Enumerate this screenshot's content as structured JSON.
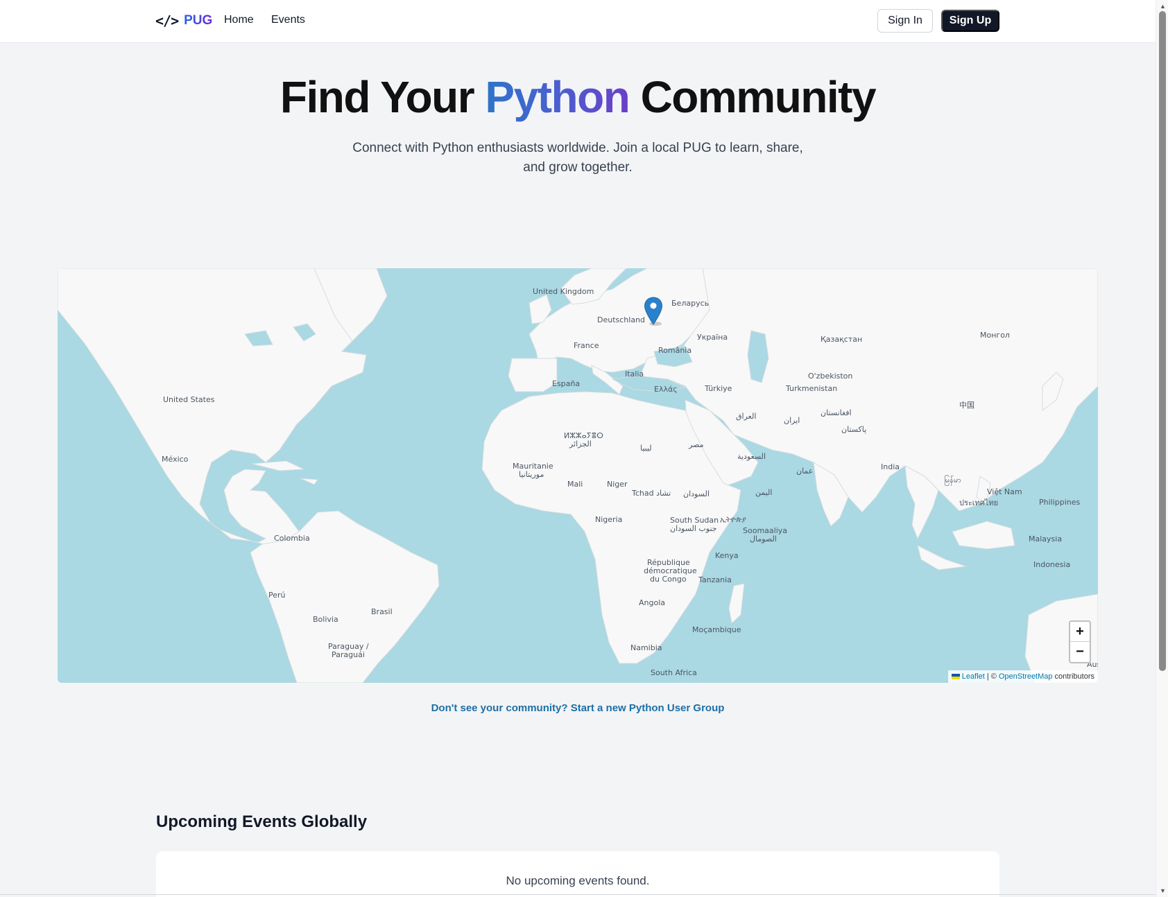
{
  "navbar": {
    "brand_icon": "</>",
    "brand_text": "PUG",
    "home": "Home",
    "events": "Events",
    "sign_in": "Sign In",
    "sign_up": "Sign Up"
  },
  "hero": {
    "title_before": "Find Your ",
    "title_accent": "Python",
    "title_after": " Community",
    "subtitle": "Connect with Python enthusiasts worldwide. Join a local PUG to learn, share, and grow together.",
    "accent_color_start": "#2f74c8",
    "accent_color_end": "#6b3fc7"
  },
  "map": {
    "labels": {
      "united_kingdom": "United Kingdom",
      "belarus": "Беларусь",
      "deutschland": "Deutschland",
      "ukraine": "Україна",
      "france": "France",
      "romania": "România",
      "kazakhstan": "Қазақстан",
      "mongolia": "Монгол",
      "uzbekistan": "O'zbekiston",
      "turkmenistan": "Turkmenistan",
      "italia": "Italia",
      "espana": "España",
      "ellas": "Ελλάς",
      "turkiye": "Türkiye",
      "united_states": "United States",
      "china": "中国",
      "iraq": "العراق",
      "iran": "ایران",
      "afghanistan": "افغانستان",
      "pakistan": "پاکستان",
      "algeria": "ⵍⵣⵣⴰⵢⴻⵔ",
      "algeria_ar": "الجزائر",
      "libya": "ليبيا",
      "egypt": "مصر",
      "mexico": "México",
      "saudi": "السعودية",
      "oman": "عمان",
      "india": "India",
      "mauritanie": "Mauritanie",
      "mauritanie_ar": "موريتانيا",
      "mali": "Mali",
      "niger": "Niger",
      "tchad": "Tchad تشاد",
      "sudan": "السودان",
      "yemen": "اليمن",
      "myanmar": "မြန်မာ",
      "vietnam": "Việt Nam",
      "thailand": "ประเทศไทย",
      "philippines": "Philippines",
      "nigeria": "Nigeria",
      "south_sudan": "South Sudan",
      "south_sudan_ar": "جنوب السودان",
      "ethiopia": "ኢትዮጵያ",
      "somalia": "Soomaaliya",
      "somalia_ar": "الصومال",
      "colombia": "Colombia",
      "malaysia": "Malaysia",
      "kenya": "Kenya",
      "drc_1": "République",
      "drc_2": "démocratique",
      "drc_3": "du Congo",
      "tanzania": "Tanzania",
      "indonesia": "Indonesia",
      "peru": "Perú",
      "brasil": "Brasil",
      "bolivia": "Bolivia",
      "angola": "Angola",
      "mozambique": "Moçambique",
      "namibia": "Namibia",
      "paraguay_1": "Paraguay /",
      "paraguay_2": "Paraguái",
      "south_africa": "South Africa",
      "australia_partial": "Aus"
    },
    "zoom_in": "+",
    "zoom_out": "−",
    "attribution": {
      "leaflet": "Leaflet",
      "separator": "| ©",
      "osm": "OpenStreetMap",
      "contributors": "contributors"
    },
    "water_color": "#aad8e3",
    "land_color": "#f8f8f8",
    "marker_color": "#2a81cb"
  },
  "new_pug_link": "Don't see your community? Start a new Python User Group",
  "events": {
    "heading": "Upcoming Events Globally",
    "empty_message": "No upcoming events found."
  },
  "scrollbar": {
    "up_arrow": "▲",
    "down_arrow": "▼"
  }
}
